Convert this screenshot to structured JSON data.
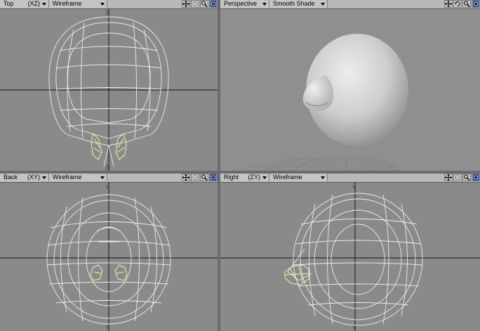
{
  "viewports": {
    "top": {
      "name": "Top",
      "axis": "(XZ)",
      "mode": "Wireframe"
    },
    "perspective": {
      "name": "Perspective",
      "mode": "Smooth Shade"
    },
    "back": {
      "name": "Back",
      "axis": "(XY)",
      "mode": "Wireframe"
    },
    "right": {
      "name": "Right",
      "axis": "(ZY)",
      "mode": "Wireframe"
    }
  },
  "controls": [
    "move-icon",
    "rotate-icon",
    "zoom-icon",
    "maximize-icon"
  ],
  "colors": {
    "background": "#8a8a8a",
    "wire": "#ececec",
    "selected": "#f2f0a6",
    "axis_line": "#111111",
    "header": "#b9b9b9"
  }
}
